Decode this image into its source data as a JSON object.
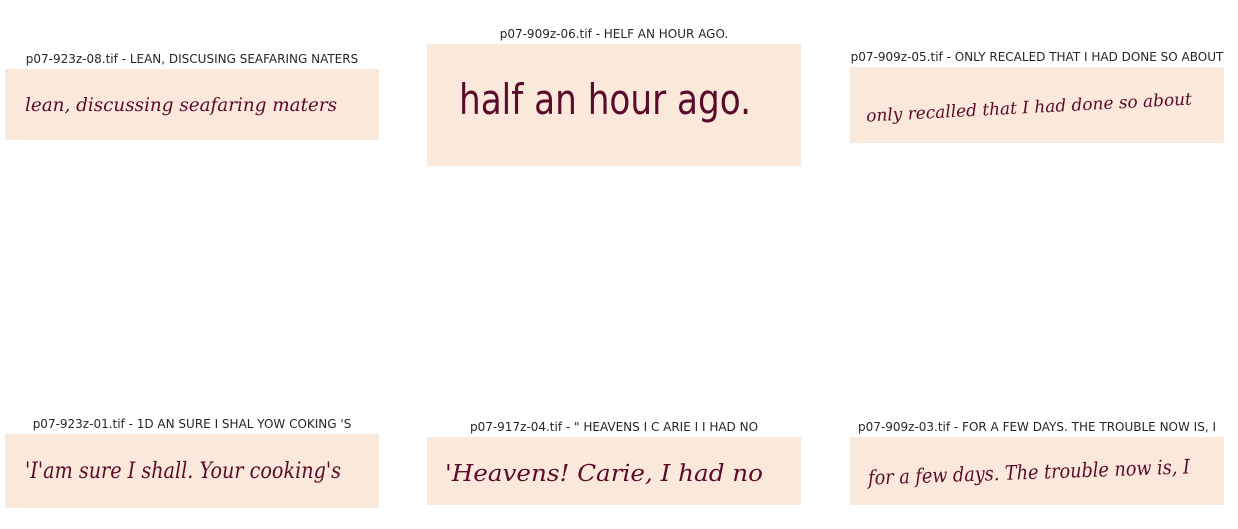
{
  "colors": {
    "sample_background": "#fae8da",
    "ink": "#5a0a2a",
    "title_text": "#262626"
  },
  "panels": [
    {
      "title": "p07-923z-08.tif - LEAN, DISCUSING SEAFARING NATERS",
      "handwriting": "lean, discussing seafaring maters"
    },
    {
      "title": "p07-909z-06.tif - HELF AN HOUR AGO.",
      "handwriting": "half an hour ago."
    },
    {
      "title": "p07-909z-05.tif - ONLY RECALED THAT I HAD DONE SO ABOUT",
      "handwriting": "only recalled that I had done so about"
    },
    {
      "title": "p07-923z-01.tif - 1D AN SURE I SHAL YOW COKING 'S",
      "handwriting": "'I'am sure I shall. Your cooking's"
    },
    {
      "title": "p07-917z-04.tif - \" HEAVENS I C ARIE I I HAD NO",
      "handwriting": "'Heavens! Carie, I had no"
    },
    {
      "title": "p07-909z-03.tif - FOR A FEW DAYS. THE TROUBLE NOW IS, I",
      "handwriting": "for a few days. The trouble now is, I"
    }
  ]
}
